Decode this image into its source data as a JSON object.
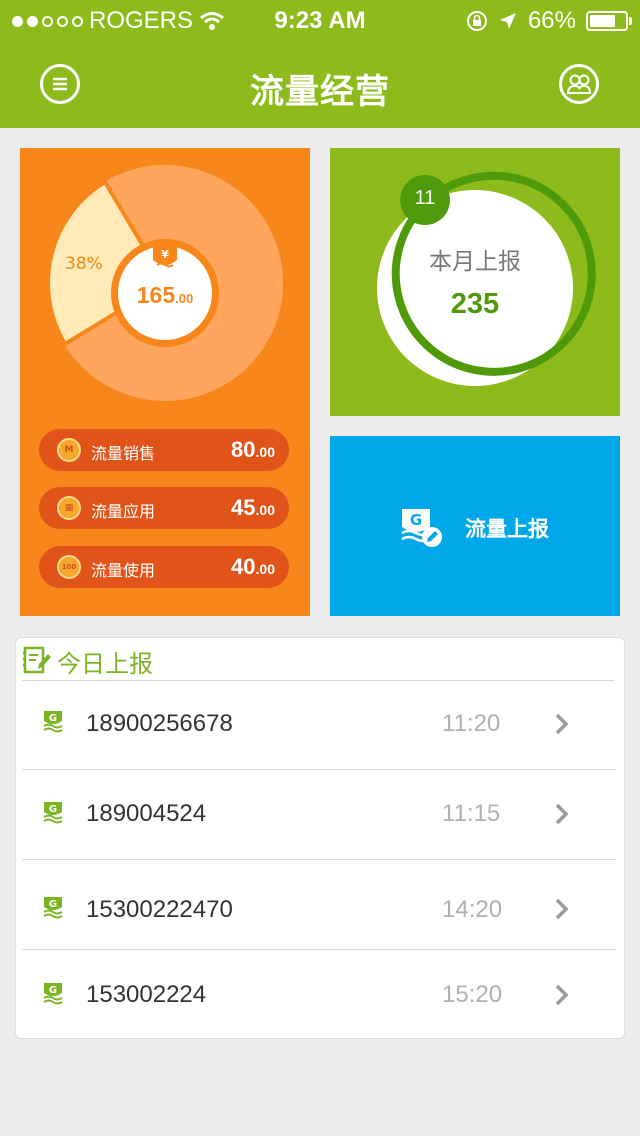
{
  "status": {
    "carrier": "ROGERS",
    "time": "9:23 AM",
    "battery": "66%",
    "battery_level": 0.66,
    "signal_bars": 2
  },
  "header": {
    "title": "流量经营"
  },
  "donut": {
    "percent_label": "38%",
    "percent_value": 38,
    "amount_main": "165",
    "amount_cents": ".00"
  },
  "stats": [
    {
      "label": "流量销售",
      "value": "80",
      "cents": ".00",
      "icon": "m-coin-icon"
    },
    {
      "label": "流量应用",
      "value": "45",
      "cents": ".00",
      "icon": "app-coin-icon"
    },
    {
      "label": "流量使用",
      "value": "40",
      "cents": ".00",
      "icon": "100-coin-icon",
      "coin_text": "100"
    }
  ],
  "monthly": {
    "badge": "11",
    "label": "本月上报",
    "count": "235"
  },
  "report_button": {
    "label": "流量上报"
  },
  "today": {
    "title": "今日上报",
    "rows": [
      {
        "phone": "18900256678",
        "time": "11:20"
      },
      {
        "phone": "189004524",
        "time": "11:15"
      },
      {
        "phone": "15300222470",
        "time": "14:20"
      },
      {
        "phone": "153002224",
        "time": "15:20"
      }
    ]
  },
  "colors": {
    "topbar": "#8dbb1c",
    "orange_card": "#f7871b",
    "green_card": "#8dbb1c",
    "blue_card": "#00a8e9",
    "accent_green": "#7cb524"
  }
}
